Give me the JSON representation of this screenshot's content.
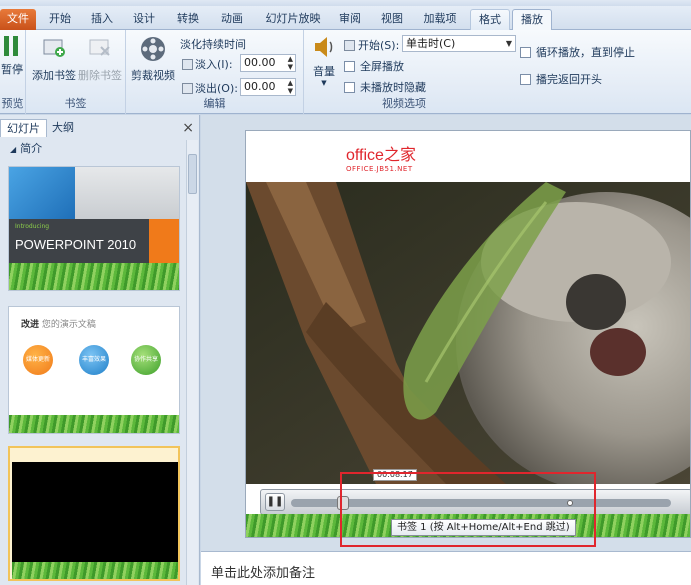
{
  "tabs": [
    "文件",
    "开始",
    "插入",
    "设计",
    "转换",
    "动画",
    "幻灯片放映",
    "审阅",
    "视图",
    "加载项",
    "格式",
    "播放"
  ],
  "ribbon": {
    "preview": {
      "button": "暂停",
      "group": "预览"
    },
    "bookmark": {
      "add": "添加书签",
      "remove": "删除书签",
      "group": "书签"
    },
    "editing": {
      "trim": "剪裁视频",
      "fade_title": "淡化持续时间",
      "fade_in_label": "淡入(I):",
      "fade_in_value": "00.00",
      "fade_out_label": "淡出(O):",
      "fade_out_value": "00.00",
      "group": "编辑"
    },
    "video_options": {
      "volume": "音量",
      "start_label": "开始(S):",
      "start_value": "单击时(C)",
      "fullscreen": "全屏播放",
      "hide": "未播放时隐藏",
      "loop": "循环播放，直到停止",
      "rewind": "播完返回开头",
      "group": "视频选项"
    }
  },
  "left_panel": {
    "tab_slides": "幻灯片",
    "tab_outline": "大纲",
    "close": "×",
    "section": "简介",
    "thumb1": {
      "small": "Introducing",
      "title": "POWERPOINT 2010"
    },
    "thumb2": {
      "title_bold": "改进",
      "title_rest": "您的演示文稿",
      "circles": [
        "媒体更新",
        "丰富效果",
        "协作共享"
      ]
    }
  },
  "slide": {
    "logo_main": "office之家",
    "logo_sub": "OFFICE.JB51.NET",
    "time_bubble": "00:08.17",
    "tooltip": "书签 1 (按 Alt+Home/Alt+End 跳过)"
  },
  "notes_placeholder": "单击此处添加备注",
  "colors": {
    "file_tab": "#d8632a",
    "highlight": "#e0262d",
    "logo_red": "#e0262d"
  }
}
